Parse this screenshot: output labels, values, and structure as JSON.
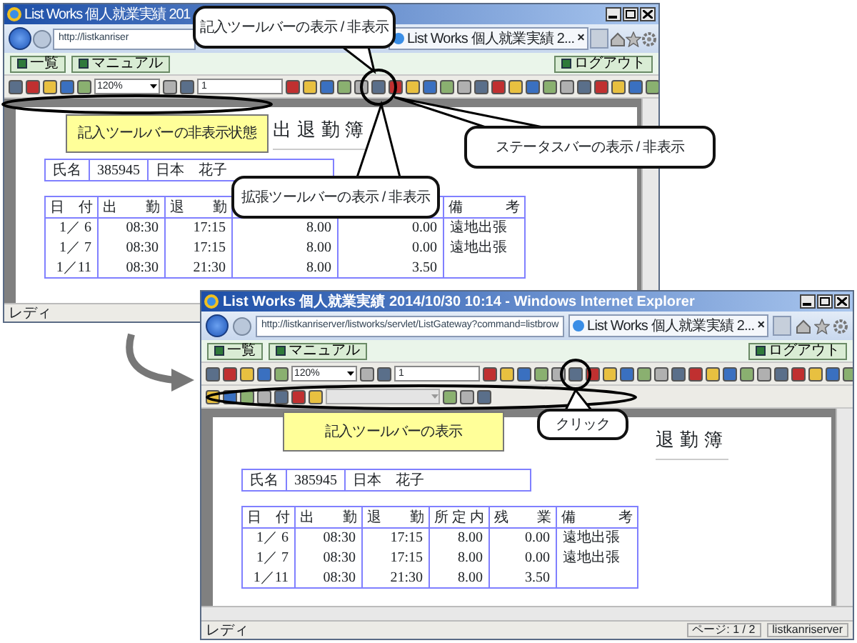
{
  "windows": [
    {
      "title": "List Works 個人就業実績 201",
      "address": "http://listkanriser",
      "tab_title": "List Works 個人就業実績 2...",
      "tab_close": "×",
      "nav_buttons": [
        "一覧",
        "マニュアル"
      ],
      "logout": "ログアウト",
      "zoom": "120%",
      "page_number": "1",
      "annotation_toolbar": false,
      "document": {
        "title": "出退勤簿",
        "name_label": "氏名",
        "employee_id": "385945",
        "employee_name": "日本　花子",
        "columns": [
          "日　付",
          "出　　勤",
          "退　　勤",
          null,
          null,
          "備　　　考"
        ],
        "rows": [
          [
            "1／ 6",
            "08:30",
            "17:15",
            "8.00",
            "0.00",
            "遠地出張"
          ],
          [
            "1／ 7",
            "08:30",
            "17:15",
            "8.00",
            "0.00",
            "遠地出張"
          ],
          [
            "1／11",
            "08:30",
            "21:30",
            "8.00",
            "3.50"
          ]
        ]
      },
      "status": {
        "ready": "レディ"
      }
    },
    {
      "title": "List Works 個人就業実績 2014/10/30 10:14 - Windows Internet Explorer",
      "address": "http://listkanriserver/listworks/servlet/ListGateway?command=listbrow",
      "tab_title": "List Works 個人就業実績 2...",
      "tab_close": "×",
      "nav_buttons": [
        "一覧",
        "マニュアル"
      ],
      "logout": "ログアウト",
      "zoom": "120%",
      "page_number": "1",
      "annotation_toolbar": true,
      "document": {
        "title": "退勤簿",
        "name_label": "氏名",
        "employee_id": "385945",
        "employee_name": "日本　花子",
        "columns": [
          "日　付",
          "出　　勤",
          "退　　勤",
          "所 定 内",
          "残　　業",
          "備　　　考"
        ],
        "rows": [
          [
            "1／ 6",
            "08:30",
            "17:15",
            "8.00",
            "0.00",
            "遠地出張"
          ],
          [
            "1／ 7",
            "08:30",
            "17:15",
            "8.00",
            "0.00",
            "遠地出張"
          ],
          [
            "1／11",
            "08:30",
            "21:30",
            "8.00",
            "3.50"
          ]
        ]
      },
      "status": {
        "ready": "レディ",
        "page_info": "ページ: 1 / 2",
        "server": "listkanriserver"
      }
    }
  ],
  "callouts": [
    {
      "kind": "bubble",
      "text": "記入ツールバーの表示 / 非表示"
    },
    {
      "kind": "note",
      "text": "記入ツールバーの非表示状態"
    },
    {
      "kind": "bubble",
      "text": "ステータスバーの表示 / 非表示"
    },
    {
      "kind": "bubble",
      "text": "拡張ツールバーの表示 / 非表示"
    },
    {
      "kind": "note",
      "text": "記入ツールバーの表示"
    },
    {
      "kind": "bubble",
      "text": "クリック"
    }
  ]
}
